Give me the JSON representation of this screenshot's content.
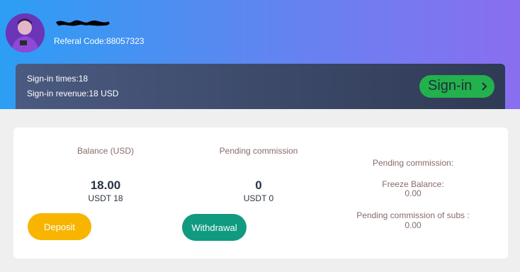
{
  "profile": {
    "referral_code": "Referal Code:88057323"
  },
  "signin": {
    "times": "Sign-in times:18",
    "revenue": "Sign-in revenue:18 USD",
    "button_label": "Sign-in",
    "button_color": "#22b14c"
  },
  "balance": {
    "label": "Balance (USD)",
    "amount": "18.00",
    "usdt": "USDT 18",
    "deposit_label": "Deposit"
  },
  "pending": {
    "label": "Pending commission",
    "amount": "0",
    "usdt": "USDT 0",
    "withdrawal_label": "Withdrawal"
  },
  "pending_details": {
    "title": "Pending commission:",
    "freeze_label": "Freeze Balance:",
    "freeze_value": "0.00",
    "subs_label": "Pending commission of subs :",
    "subs_value": "0.00"
  },
  "colors": {
    "deposit": "#f7b500",
    "withdrawal": "#109a7f",
    "header_start": "#2c9ef4",
    "header_end": "#8a6ef0"
  }
}
